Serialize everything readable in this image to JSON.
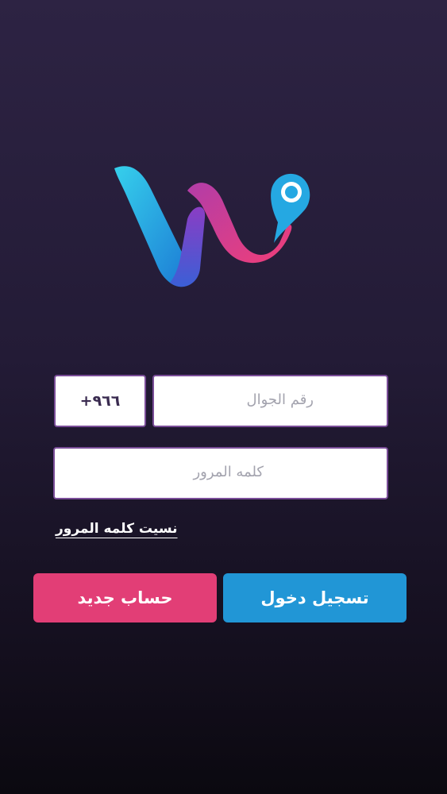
{
  "logo": {
    "icon": "w-location-logo",
    "colors": [
      "#2fc6e8",
      "#1e7fd8",
      "#7d3fc7",
      "#e23d83",
      "#25a6e0"
    ]
  },
  "form": {
    "country_code": "+٩٦٦",
    "phone_placeholder": "رقم الجوال",
    "password_placeholder": "كلمه المرور",
    "forgot_password": "نسيت كلمه المرور"
  },
  "buttons": {
    "login": "تسجيل دخول",
    "register": "حساب جديد"
  },
  "colors": {
    "background_top": "#2d2343",
    "background_bottom": "#0b0910",
    "input_border": "#7a4d98",
    "login_button": "#2196d6",
    "register_button": "#e23e76"
  }
}
